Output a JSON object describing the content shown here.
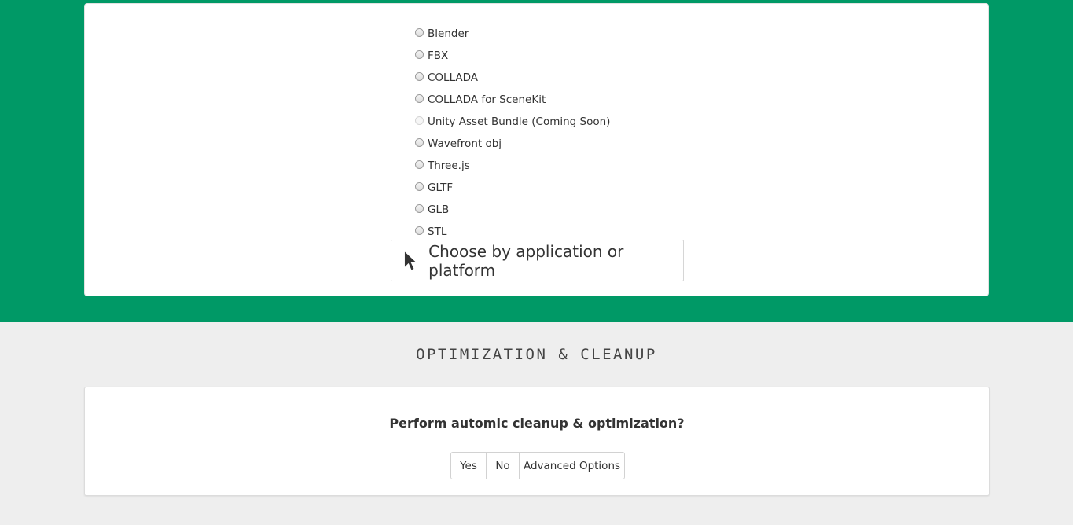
{
  "colors": {
    "band": "#009966",
    "background": "#eeeeee"
  },
  "formats": [
    {
      "label": "Blender",
      "disabled": false
    },
    {
      "label": "FBX",
      "disabled": false
    },
    {
      "label": "COLLADA",
      "disabled": false
    },
    {
      "label": "COLLADA for SceneKit",
      "disabled": false
    },
    {
      "label": "Unity Asset Bundle (Coming Soon)",
      "disabled": true
    },
    {
      "label": "Wavefront obj",
      "disabled": false
    },
    {
      "label": "Three.js",
      "disabled": false
    },
    {
      "label": "GLTF",
      "disabled": false
    },
    {
      "label": "GLB",
      "disabled": false
    },
    {
      "label": "STL",
      "disabled": false
    }
  ],
  "choose_button": {
    "label": "Choose by application or platform",
    "icon": "cursor-pointer-icon"
  },
  "optimization": {
    "title": "OPTIMIZATION & CLEANUP",
    "question": "Perform automic cleanup & optimization?",
    "buttons": {
      "yes": "Yes",
      "no": "No",
      "advanced": "Advanced Options"
    }
  }
}
